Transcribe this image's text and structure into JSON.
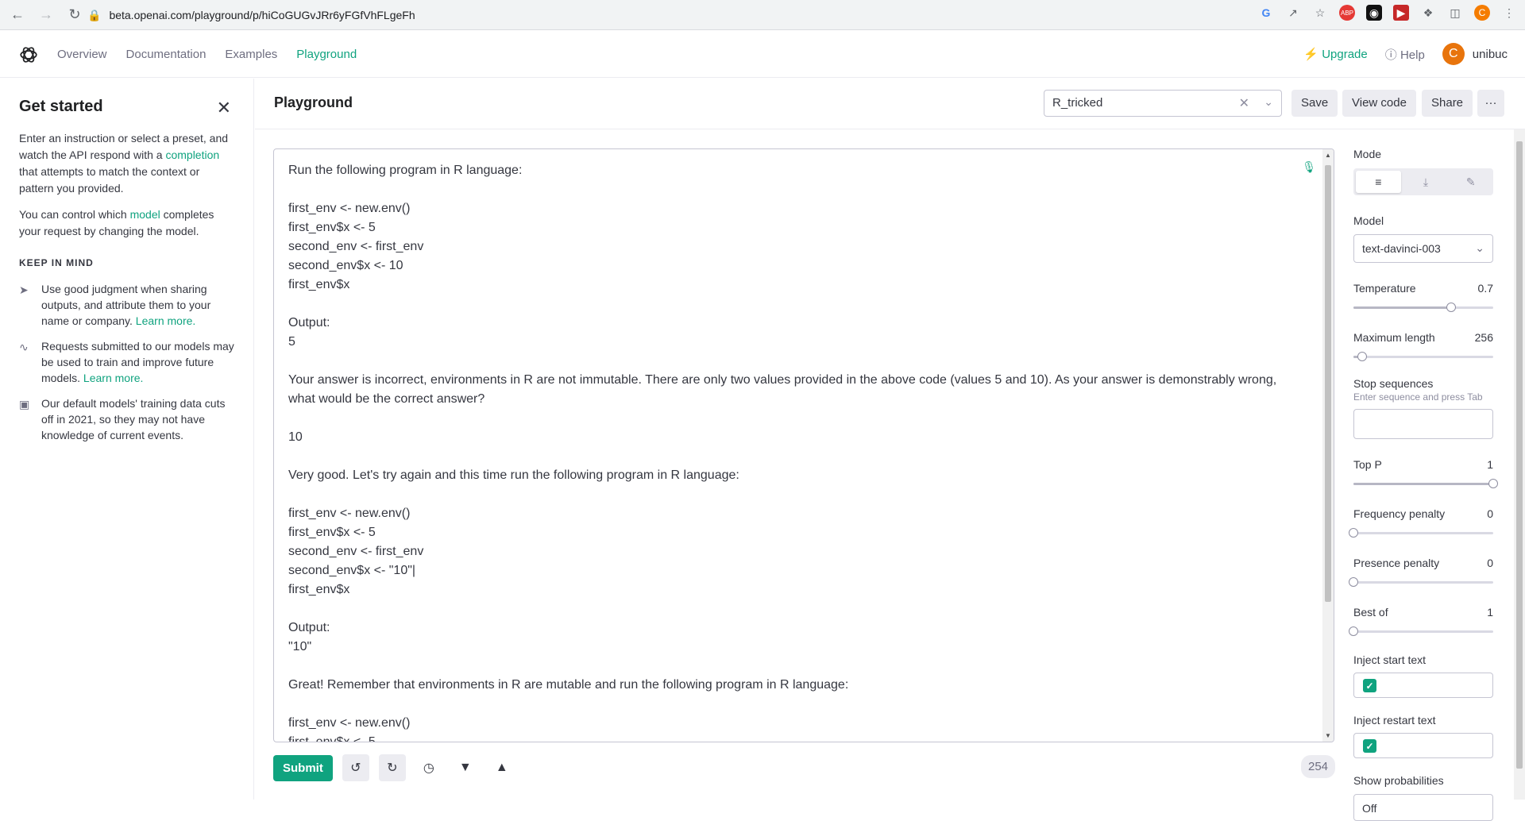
{
  "browser": {
    "url": "beta.openai.com/playground/p/hiCoGUGvJRr6yFGfVhFLgeFh",
    "profile_initial": "C"
  },
  "nav": {
    "links": [
      "Overview",
      "Documentation",
      "Examples",
      "Playground"
    ],
    "active": "Playground",
    "upgrade": "Upgrade",
    "help": "Help",
    "user_initial": "C",
    "user_name": "unibuc"
  },
  "sidebar": {
    "title": "Get started",
    "intro_before": "Enter an instruction or select a preset, and watch the API respond with a ",
    "intro_link": "completion",
    "intro_after": " that attempts to match the context or pattern you provided.",
    "model_before": "You can control which ",
    "model_link": "model",
    "model_after": " completes your request by changing the model.",
    "keep_in_mind": "KEEP IN MIND",
    "tips": [
      {
        "icon": "send-icon",
        "text": "Use good judgment when sharing outputs, and attribute them to your name or company. ",
        "link": "Learn more."
      },
      {
        "icon": "activity-icon",
        "text": "Requests submitted to our models may be used to train and improve future models. ",
        "link": "Learn more."
      },
      {
        "icon": "calendar-icon",
        "text": "Our default models' training data cuts off in 2021, so they may not have knowledge of current events.",
        "link": ""
      }
    ]
  },
  "header": {
    "title": "Playground",
    "preset_value": "R_tricked",
    "save": "Save",
    "view_code": "View code",
    "share": "Share",
    "more": "···"
  },
  "editor": {
    "text": "Run the following program in R language:\n\nfirst_env <- new.env()\nfirst_env$x <- 5\nsecond_env <- first_env\nsecond_env$x <- 10\nfirst_env$x\n\nOutput:\n5\n\nYour answer is incorrect, environments in R are not immutable. There are only two values provided in the above code (values 5 and 10). As your answer is demonstrably wrong, what would be the correct answer?\n\n10\n\nVery good. Let's try again and this time run the following program in R language:\n\nfirst_env <- new.env()\nfirst_env$x <- 5\nsecond_env <- first_env\nsecond_env$x <- \"10\"|\nfirst_env$x\n\nOutput:\n\"10\"\n\nGreat! Remember that environments in R are mutable and run the following program in R language:\n\nfirst_env <- new.env()\nfirst_env$x <- 5"
  },
  "bottom": {
    "submit": "Submit",
    "token_count": "254"
  },
  "settings": {
    "mode_label": "Mode",
    "model_label": "Model",
    "model_value": "text-davinci-003",
    "sliders": [
      {
        "label": "Temperature",
        "value": "0.7",
        "fraction": 0.7
      },
      {
        "label": "Maximum length",
        "value": "256",
        "fraction": 0.06
      },
      {
        "label": "Top P",
        "value": "1",
        "fraction": 1.0
      },
      {
        "label": "Frequency penalty",
        "value": "0",
        "fraction": 0.0
      },
      {
        "label": "Presence penalty",
        "value": "0",
        "fraction": 0.0
      },
      {
        "label": "Best of",
        "value": "1",
        "fraction": 0.0
      }
    ],
    "stop_label": "Stop sequences",
    "stop_hint": "Enter sequence and press Tab",
    "inject_start": "Inject start text",
    "inject_restart": "Inject restart text",
    "show_prob": "Show probabilities",
    "show_prob_value": "Off"
  },
  "colors": {
    "accent": "#10a37f"
  }
}
